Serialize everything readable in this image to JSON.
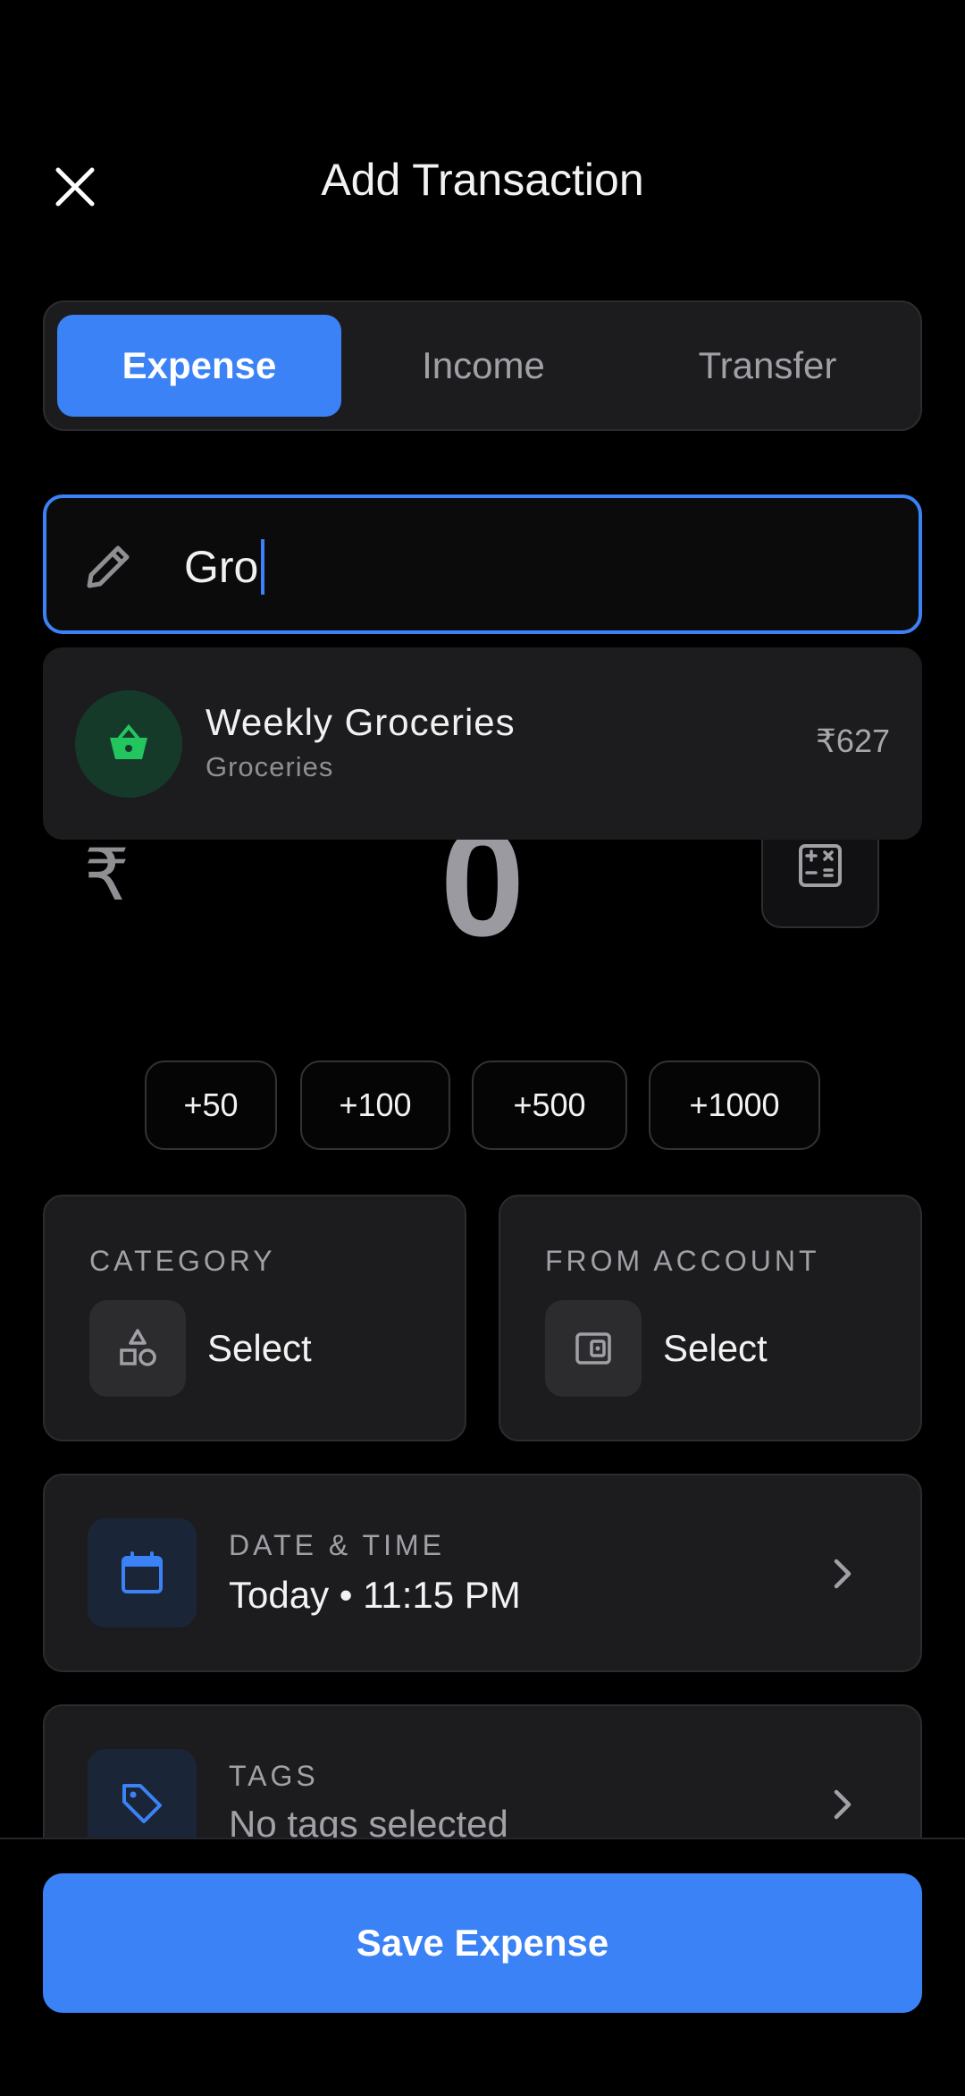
{
  "header": {
    "title": "Add Transaction",
    "close_icon": "close-icon"
  },
  "type_tabs": [
    {
      "label": "Expense",
      "active": true
    },
    {
      "label": "Income",
      "active": false
    },
    {
      "label": "Transfer",
      "active": false
    }
  ],
  "description_input": {
    "value": "Gro",
    "icon": "pencil-icon"
  },
  "suggestion": {
    "name": "Weekly Groceries",
    "category": "Groceries",
    "amount": "₹627",
    "icon": "basket-icon",
    "accent_color": "#22c55e"
  },
  "amount": {
    "currency_symbol": "₹",
    "value": "0",
    "calculator_icon": "calculator-icon"
  },
  "quick_add": [
    "+50",
    "+100",
    "+500",
    "+1000"
  ],
  "category": {
    "label": "CATEGORY",
    "value": "Select",
    "icon": "shapes-icon"
  },
  "from_account": {
    "label": "FROM ACCOUNT",
    "value": "Select",
    "icon": "wallet-icon"
  },
  "date_time": {
    "label": "DATE & TIME",
    "value": "Today • 11:15 PM",
    "icon": "calendar-icon"
  },
  "tags": {
    "label": "TAGS",
    "value": "No tags selected",
    "icon": "tag-icon"
  },
  "save_button": {
    "label": "Save Expense"
  },
  "colors": {
    "accent": "#3b82f6",
    "background": "#000000",
    "card": "#1c1c1e"
  }
}
